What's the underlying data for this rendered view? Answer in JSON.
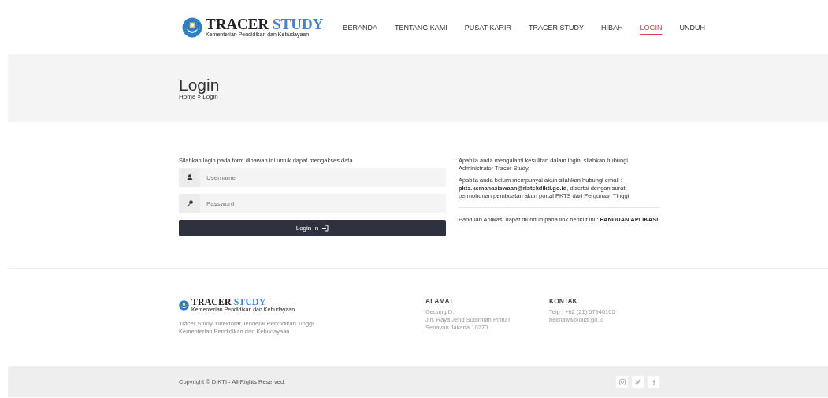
{
  "brand": {
    "name": "TRACER",
    "name_accent": "STUDY",
    "subtitle": "Kementerian Pendidikan dan Kebudayaan"
  },
  "nav": [
    {
      "label": "BERANDA",
      "selected": false
    },
    {
      "label": "TENTANG KAMI",
      "selected": false
    },
    {
      "label": "PUSAT KARIR",
      "selected": false
    },
    {
      "label": "TRACER STUDY",
      "selected": false
    },
    {
      "label": "HIBAH",
      "selected": false
    },
    {
      "label": "LOGIN",
      "selected": true
    },
    {
      "label": "UNDUH",
      "selected": false
    }
  ],
  "page_header": {
    "title": "Login",
    "breadcrumb": "Home » Login"
  },
  "login_form": {
    "intro": "Silahkan login pada form dibawah ini untuk dapat mengakses data",
    "username": {
      "placeholder": "Username"
    },
    "password": {
      "placeholder": "Password"
    },
    "submit": "Login In"
  },
  "help": {
    "paragraphs": [
      "Apabila anda mengalami kesulitan dalam login, silahkan hubungi Administrator Tracer Study.",
      "Apabila anda belum mempunyai akun silahkan hubungi email : **pkts.kemahasiswaan@ristekdikti.go.id**, disertai dengan surat permohonan pembuatan akun portal PKTS dari Perguruan Tinggi"
    ],
    "guide": "Panduan Aplikasi dapat diunduh pada link berikut ini : ",
    "guide_link": "PANDUAN APLIKASI"
  },
  "footer": {
    "brand": {
      "name": "TRACER",
      "name_accent": "STUDY",
      "subtitle": "Kementerian Pendidikan dan Kebudayaan"
    },
    "about": [
      "Tracer Study, Direktorat Jenderal Pendidikan Tinggi",
      "Kementerian Pendidikan dan Kebudayaan"
    ],
    "columns": [
      {
        "heading": "ALAMAT",
        "lines": [
          "Gedung D.",
          "Jln. Raya Jend Sudirman Pintu I",
          "Senayan Jakarta 10270"
        ]
      },
      {
        "heading": "KONTAK",
        "lines": [
          "Telp : +62 (21) 57946105",
          "belmawa@dikti.go.id"
        ]
      }
    ]
  },
  "bottom_bar": {
    "copyright": "Copyright © DIKTI - All Rights Reserved.",
    "social": [
      {
        "kind": "instagram"
      },
      {
        "kind": "twitter"
      },
      {
        "kind": "facebook"
      }
    ]
  }
}
